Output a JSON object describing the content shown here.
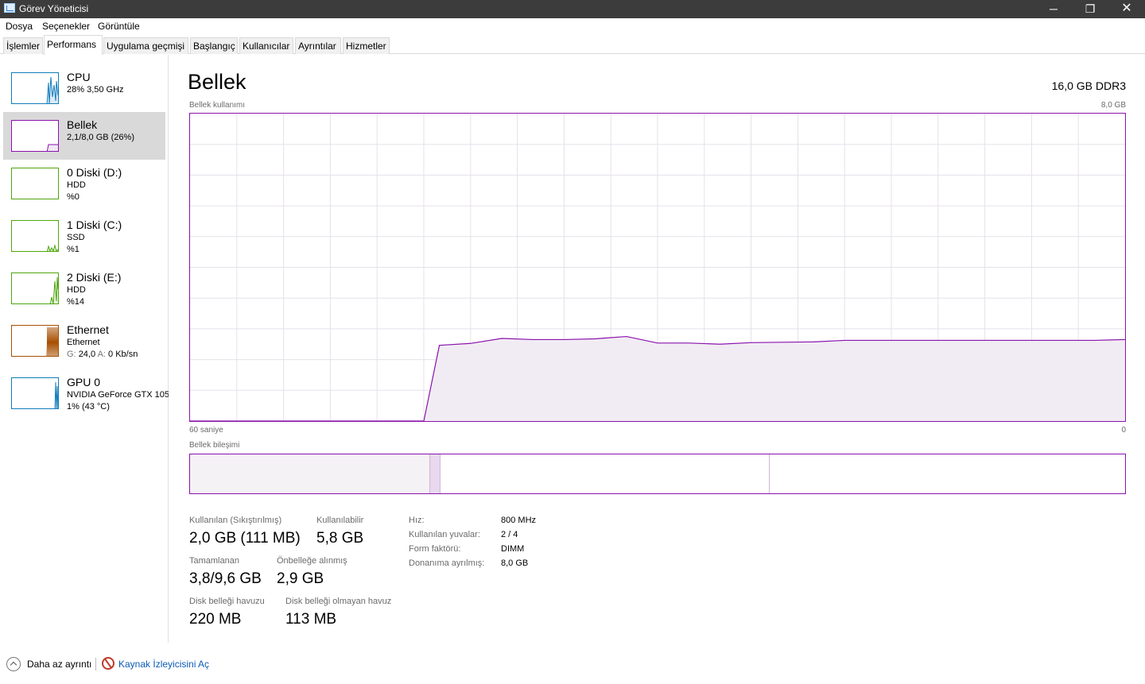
{
  "window": {
    "title": "Görev Yöneticisi",
    "minimize": "─",
    "maximize": "❐",
    "close": "✕"
  },
  "menu": [
    "Dosya",
    "Seçenekler",
    "Görüntüle"
  ],
  "tabs": [
    "İşlemler",
    "Performans",
    "Uygulama geçmişi",
    "Başlangıç",
    "Kullanıcılar",
    "Ayrıntılar",
    "Hizmetler"
  ],
  "active_tab": "Performans",
  "sidebar": [
    {
      "name": "CPU",
      "line1": "28%  3,50 GHz",
      "line2": "",
      "color": "#117dbb"
    },
    {
      "name": "Bellek",
      "line1": "2,1/8,0 GB (26%)",
      "line2": "",
      "color": "#8b12ae"
    },
    {
      "name": "0 Diski (D:)",
      "line1": "HDD",
      "line2": "%0",
      "color": "#4da60c"
    },
    {
      "name": "1 Diski (C:)",
      "line1": "SSD",
      "line2": "%1",
      "color": "#4da60c"
    },
    {
      "name": "2 Diski (E:)",
      "line1": "HDD",
      "line2": "%14",
      "color": "#4da60c"
    },
    {
      "name": "Ethernet",
      "line1": "Ethernet",
      "line2_g": "G:",
      "line2_g_val": "24,0",
      "line2_a": "A:",
      "line2_a_val": "0 Kb/sn",
      "color": "#a74f01"
    },
    {
      "name": "GPU 0",
      "line1": "NVIDIA GeForce GTX 105",
      "line2": "1% (43 °C)",
      "color": "#117dbb"
    }
  ],
  "main": {
    "title": "Bellek",
    "spec": "16,0 GB DDR3",
    "graph_label": "Bellek kullanımı",
    "graph_max": "8,0 GB",
    "graph_time_left": "60 saniye",
    "graph_time_right": "0",
    "composition_label": "Bellek bileşimi"
  },
  "memory_history": {
    "type": "area",
    "ylim": [
      0,
      8.0
    ],
    "unit": "GB",
    "x_seconds_ago": [
      60,
      45,
      44,
      42,
      40,
      38,
      36,
      34,
      32,
      30,
      28,
      26,
      24,
      22,
      20,
      18,
      16,
      14,
      12,
      10,
      8,
      6,
      4,
      2,
      0
    ],
    "values": [
      0,
      0,
      1.97,
      2.02,
      2.15,
      2.12,
      2.12,
      2.14,
      2.2,
      2.03,
      2.03,
      2.0,
      2.04,
      2.05,
      2.06,
      2.1,
      2.1,
      2.1,
      2.1,
      2.1,
      2.1,
      2.1,
      2.1,
      2.1,
      2.12
    ]
  },
  "stats": {
    "in_use_label": "Kullanılan (Sıkıştırılmış)",
    "in_use_value": "2,0 GB (111 MB)",
    "available_label": "Kullanılabilir",
    "available_value": "5,8 GB",
    "committed_label": "Tamamlanan",
    "committed_value": "3,8/9,6 GB",
    "cached_label": "Önbelleğe alınmış",
    "cached_value": "2,9 GB",
    "paged_label": "Disk belleği havuzu",
    "paged_value": "220 MB",
    "nonpaged_label": "Disk belleği olmayan havuz",
    "nonpaged_value": "113 MB"
  },
  "details": [
    {
      "label": "Hız:",
      "value": "800 MHz"
    },
    {
      "label": "Kullanılan yuvalar:",
      "value": "2 / 4"
    },
    {
      "label": "Form faktörü:",
      "value": "DIMM"
    },
    {
      "label": "Donanıma ayrılmış:",
      "value": "8,0 GB"
    }
  ],
  "footer": {
    "fewer_details": "Daha az ayrıntı",
    "open_resmon": "Kaynak İzleyicisini Aç"
  },
  "colors": {
    "memory": "#8b12ae",
    "grid": "#e6e0ea",
    "selected": "#d9d9d9"
  }
}
